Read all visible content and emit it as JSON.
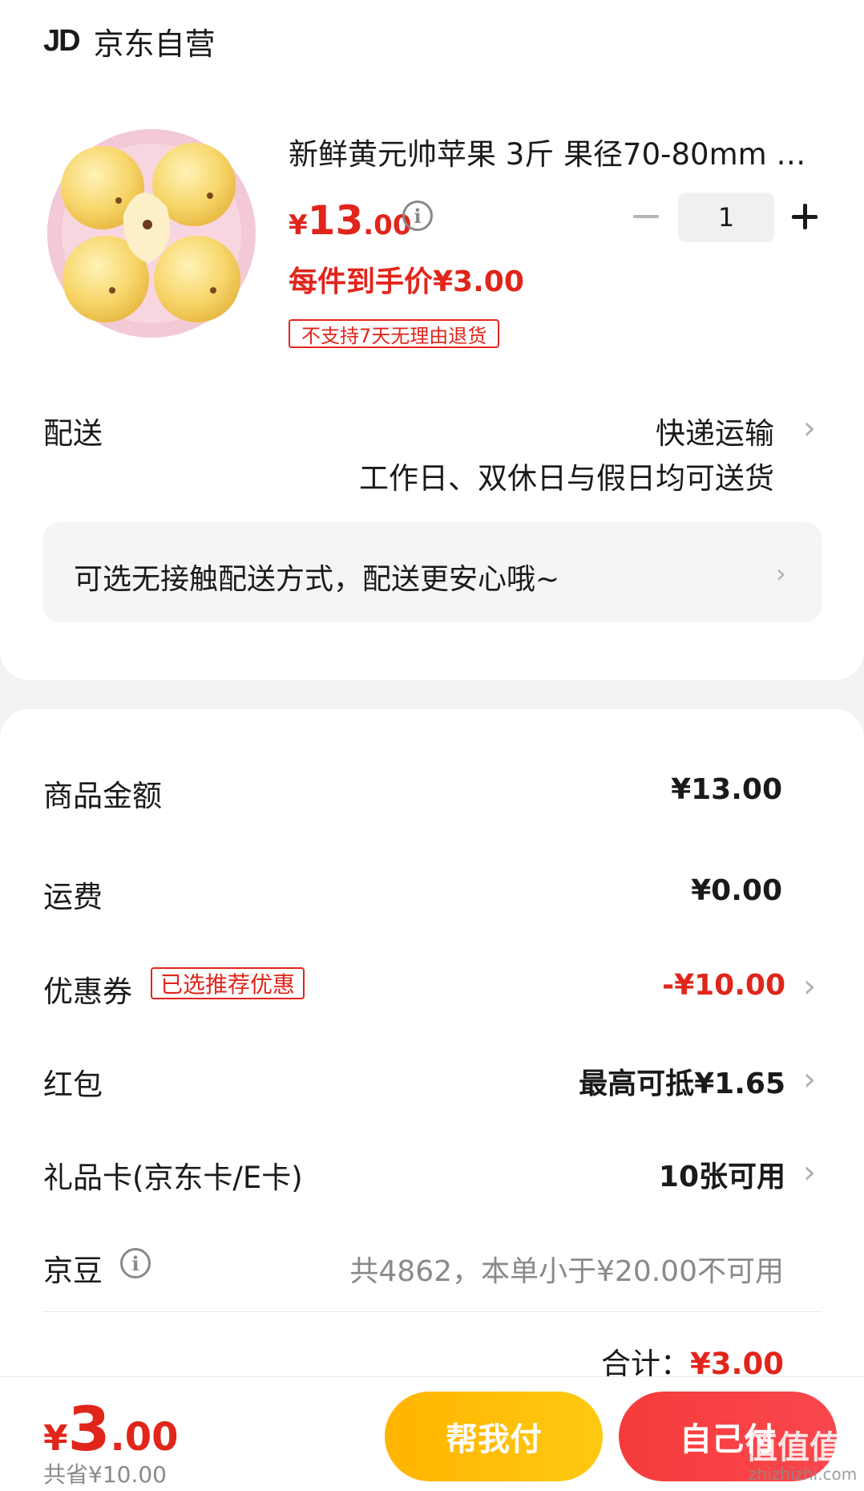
{
  "shop": {
    "logo": "JD",
    "name": "京东自营"
  },
  "product": {
    "title": "新鲜黄元帅苹果 3斤 果径70-80mm …",
    "price_symbol": "¥",
    "price_int": "13",
    "price_dec": ".00",
    "unit_price": "每件到手价¥3.00",
    "return_badge": "不支持7天无理由退货",
    "quantity": "1"
  },
  "delivery": {
    "label": "配送",
    "method": "快递运输",
    "time": "工作日、双休日与假日均可送货",
    "contactless": "可选无接触配送方式，配送更安心哦~"
  },
  "fees": {
    "goods_label": "商品金额",
    "goods_value": "¥13.00",
    "shipping_label": "运费",
    "shipping_value": "¥0.00",
    "coupon_label": "优惠券",
    "coupon_badge": "已选推荐优惠",
    "coupon_value": "-¥10.00",
    "redpacket_label": "红包",
    "redpacket_value": "最高可抵¥1.65",
    "giftcard_label": "礼品卡(京东卡/E卡)",
    "giftcard_value": "10张可用",
    "beans_label": "京豆",
    "beans_value": "共4862，本单小于¥20.00不可用",
    "total_label": "合计：",
    "total_value": "¥3.00"
  },
  "bottom": {
    "price_symbol": "¥",
    "price_int": "3",
    "price_dec": ".00",
    "saved": "共省¥10.00",
    "help_pay": "帮我付",
    "self_pay": "自己付"
  },
  "watermark": {
    "main": "值值值",
    "sub": "zhizhizhi.com"
  },
  "colors": {
    "accent_red": "#e1251b",
    "help_yellow": "#ffb400",
    "pay_red": "#f73b3b"
  },
  "icons": [
    "info-icon",
    "chevron-right-icon",
    "minus-icon",
    "plus-icon",
    "apple-product-image"
  ]
}
